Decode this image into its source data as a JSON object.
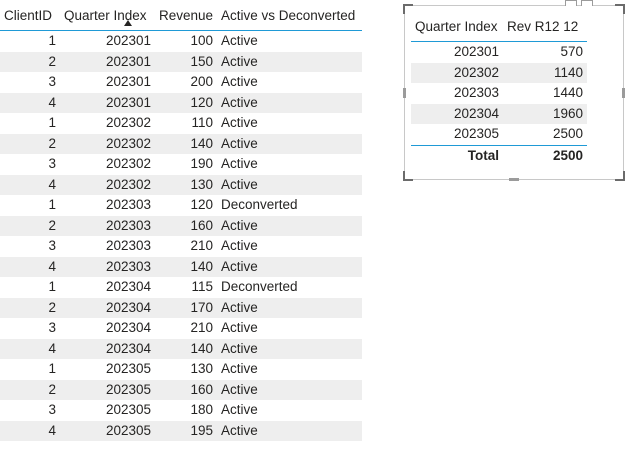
{
  "left_table": {
    "headers": [
      "ClientID",
      "Quarter Index",
      "Revenue",
      "Active vs Deconverted"
    ],
    "rows": [
      [
        "1",
        "202301",
        "100",
        "Active"
      ],
      [
        "2",
        "202301",
        "150",
        "Active"
      ],
      [
        "3",
        "202301",
        "200",
        "Active"
      ],
      [
        "4",
        "202301",
        "120",
        "Active"
      ],
      [
        "1",
        "202302",
        "110",
        "Active"
      ],
      [
        "2",
        "202302",
        "140",
        "Active"
      ],
      [
        "3",
        "202302",
        "190",
        "Active"
      ],
      [
        "4",
        "202302",
        "130",
        "Active"
      ],
      [
        "1",
        "202303",
        "120",
        "Deconverted"
      ],
      [
        "2",
        "202303",
        "160",
        "Active"
      ],
      [
        "3",
        "202303",
        "210",
        "Active"
      ],
      [
        "4",
        "202303",
        "140",
        "Active"
      ],
      [
        "1",
        "202304",
        "115",
        "Deconverted"
      ],
      [
        "2",
        "202304",
        "170",
        "Active"
      ],
      [
        "3",
        "202304",
        "210",
        "Active"
      ],
      [
        "4",
        "202304",
        "140",
        "Active"
      ],
      [
        "1",
        "202305",
        "130",
        "Active"
      ],
      [
        "2",
        "202305",
        "160",
        "Active"
      ],
      [
        "3",
        "202305",
        "180",
        "Active"
      ],
      [
        "4",
        "202305",
        "195",
        "Active"
      ]
    ],
    "sort_icon": "sort-ascending-icon"
  },
  "right_table": {
    "headers": [
      "Quarter Index",
      "Rev R12 12"
    ],
    "rows": [
      [
        "202301",
        "570"
      ],
      [
        "202302",
        "1140"
      ],
      [
        "202303",
        "1440"
      ],
      [
        "202304",
        "1960"
      ],
      [
        "202305",
        "2500"
      ]
    ],
    "total_label": "Total",
    "total_value": "2500"
  },
  "colors": {
    "header_rule": "#1f9ad6",
    "zebra": "#eeeeee",
    "text": "#252423"
  }
}
